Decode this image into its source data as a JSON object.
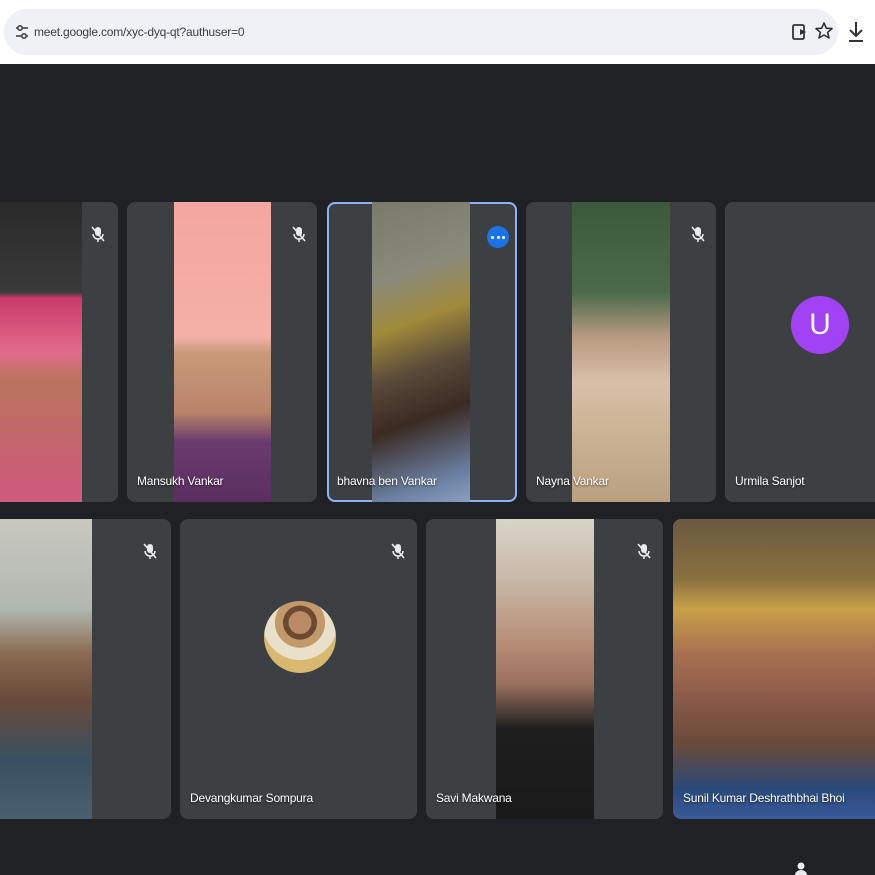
{
  "browser": {
    "url": "meet.google.com/xyc-dyq-qt?authuser=0"
  },
  "icons": {
    "site_settings": "tune-icon",
    "install_app": "install-icon",
    "bookmark": "star-icon",
    "downloads": "download-icon",
    "mic_off": "mic-off-icon",
    "speaking": "speaking-indicator-icon"
  },
  "colors": {
    "page_bg": "#202124",
    "tile_bg": "#3c4043",
    "active_outline": "#8ab4f8",
    "speaking_badge": "#1a73e8",
    "avatar_u": "#a142f4"
  },
  "participants": [
    {
      "name": "",
      "muted": true
    },
    {
      "name": "Mansukh Vankar",
      "muted": true
    },
    {
      "name": "bhavna ben Vankar",
      "muted": false,
      "speaking": true
    },
    {
      "name": "Nayna Vankar",
      "muted": true
    },
    {
      "name": "Urmila Sanjot",
      "muted": true,
      "avatar_letter": "U"
    },
    {
      "name": "",
      "muted": true
    },
    {
      "name": "Devangkumar Sompura",
      "muted": true
    },
    {
      "name": "Savi Makwana",
      "muted": true
    },
    {
      "name": "Sunil Kumar Deshrathbhai Bhoi",
      "muted": false
    }
  ]
}
